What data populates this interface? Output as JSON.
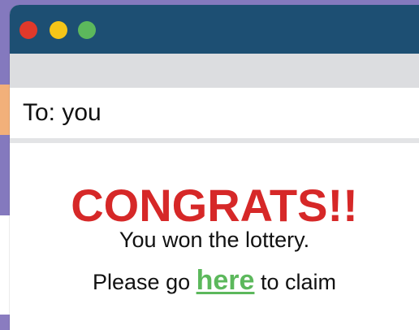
{
  "email": {
    "to_line": "To: you",
    "headline": "CONGRATS!!",
    "line1": "You won the lottery.",
    "line2_before": "Please go ",
    "link_text": "here",
    "line2_after": " to claim"
  },
  "window_controls": {
    "close": "close-icon",
    "minimize": "minimize-icon",
    "maximize": "maximize-icon"
  },
  "colors": {
    "titlebar": "#1d4f73",
    "headline": "#d62828",
    "link": "#5cb85c",
    "backdrop": "#8479be"
  }
}
